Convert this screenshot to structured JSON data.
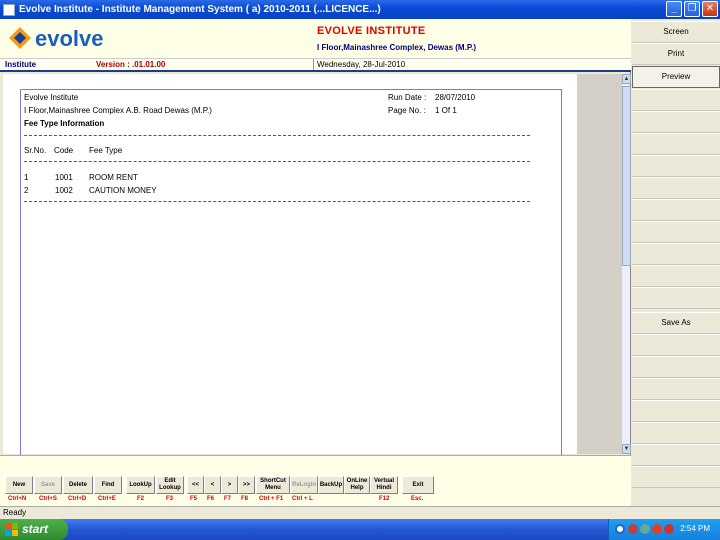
{
  "window": {
    "title": "Evolve Institute - Institute Management System ( a) 2010-2011 (...LICENCE...)",
    "minimize_icon": "minimize-icon",
    "restore_icon": "restore-icon",
    "close_icon": "close-icon"
  },
  "header": {
    "logo_text": "evolve",
    "institute_name": "EVOLVE INSTITUTE",
    "institute_address": "I Floor,Mainashree Complex, Dewas (M.P.)",
    "module": "Institute",
    "version": "Version : .01.01.00",
    "date": "Wednesday, 28-Jul-2010"
  },
  "report": {
    "org": "Evolve Institute",
    "address": "I Floor,Mainashree Complex A.B. Road Dewas (M.P.)",
    "title": "Fee Type Information",
    "run_date_label": "Run Date :",
    "run_date": "28/07/2010",
    "page_label": "Page No. :",
    "page_value": "1 Of 1",
    "columns": [
      "Sr.No.",
      "Code",
      "Fee Type"
    ],
    "rows": [
      [
        "1",
        "1001",
        "ROOM RENT"
      ],
      [
        "2",
        "1002",
        "CAUTION MONEY"
      ]
    ]
  },
  "side_panel": {
    "buttons": [
      "Screen",
      "Print",
      "Preview",
      "Save As"
    ]
  },
  "toolbar": {
    "buttons": [
      {
        "label": "New",
        "key": "Ctrl+N"
      },
      {
        "label": "Save",
        "key": "Ctrl+S"
      },
      {
        "label": "Delete",
        "key": "Ctrl+D"
      },
      {
        "label": "Find",
        "key": "Ctrl+E"
      },
      {
        "label": "LookUp",
        "key": "F2"
      },
      {
        "label": "Edit Lookup",
        "key": "F3"
      },
      {
        "label": "<<",
        "key": "F5"
      },
      {
        "label": "<",
        "key": "F6"
      },
      {
        "label": ">",
        "key": "F7"
      },
      {
        "label": ">>",
        "key": "F8"
      },
      {
        "label": "ShortCut Menu",
        "key": "Ctrl + F1"
      },
      {
        "label": "ReLogin",
        "key": "Ctrl + L"
      },
      {
        "label": "BackUp",
        "key": ""
      },
      {
        "label": "OnLine Help",
        "key": ""
      },
      {
        "label": "Vertual Hindi",
        "key": "F12"
      },
      {
        "label": "Exit",
        "key": "Esc."
      }
    ]
  },
  "status": {
    "text": "Ready"
  },
  "taskbar": {
    "start_label": "start",
    "clock": "2:54 PM"
  }
}
